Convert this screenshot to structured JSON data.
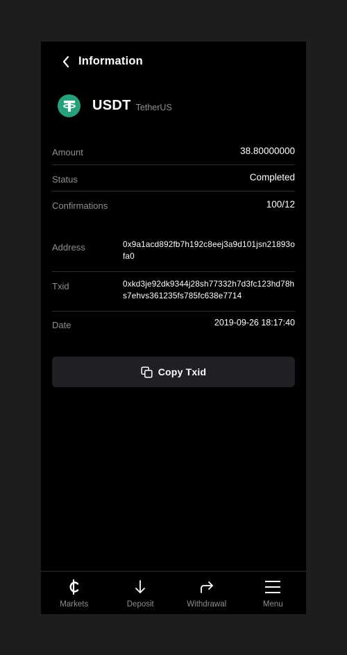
{
  "header": {
    "title": "Information"
  },
  "coin": {
    "symbol": "USDT",
    "name": "TetherUS",
    "logo_icon": "tether-logo-icon",
    "logo_color": "#26a17b"
  },
  "details": {
    "amount": {
      "label": "Amount",
      "value": "38.80000000"
    },
    "status": {
      "label": "Status",
      "value": "Completed"
    },
    "confirmations": {
      "label": "Confirmations",
      "value": "100/12"
    },
    "address": {
      "label": "Address",
      "value": "0x9a1acd892fb7h192c8eej3a9d101jsn21893ofa0"
    },
    "txid": {
      "label": "Txid",
      "value": "0xkd3je92dk9344j28sh77332h7d3fc123hd78hs7ehvs361235fs785fc638e7714"
    },
    "date": {
      "label": "Date",
      "value": "2019-09-26 18:17:40"
    }
  },
  "copy_button": {
    "label": "Copy Txid",
    "icon": "copy-icon"
  },
  "tabbar": {
    "items": [
      {
        "label": "Markets",
        "icon": "cedi-icon"
      },
      {
        "label": "Deposit",
        "icon": "arrow-down-icon"
      },
      {
        "label": "Withdrawal",
        "icon": "share-arrow-icon"
      },
      {
        "label": "Menu",
        "icon": "hamburger-menu-icon"
      }
    ]
  },
  "colors": {
    "background": "#000000",
    "outer": "#1c1d1f",
    "muted_text": "#8d8f93",
    "button_bg": "#1f2023",
    "accent": "#26a17b"
  }
}
